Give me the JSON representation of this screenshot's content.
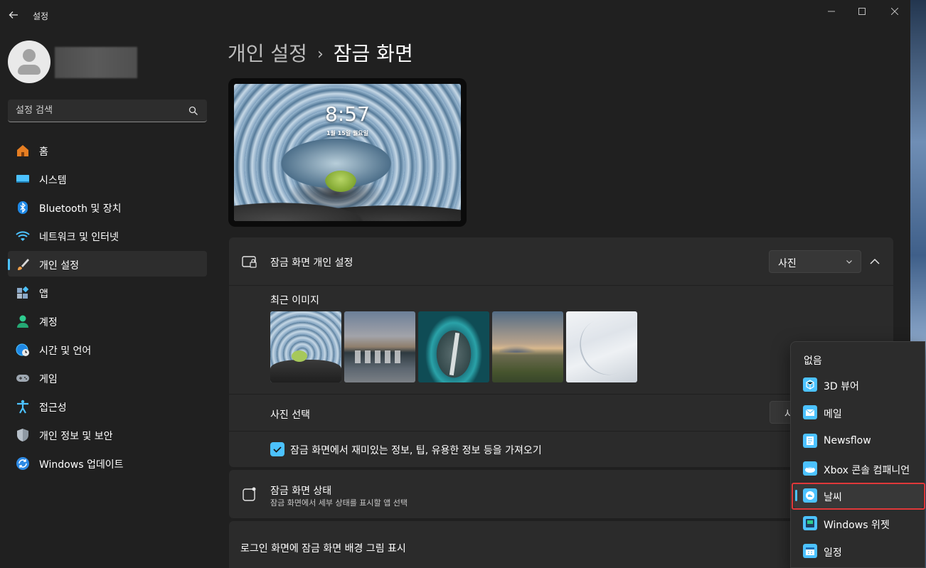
{
  "window": {
    "title": "설정",
    "back_icon": "arrow-left-icon",
    "controls": [
      "minimize-icon",
      "maximize-icon",
      "close-icon"
    ]
  },
  "sidebar": {
    "search_placeholder": "설정 검색",
    "items": [
      {
        "label": "홈",
        "icon": "home-icon",
        "color": "#e67e22"
      },
      {
        "label": "시스템",
        "icon": "system-icon",
        "color": "#4cc2ff"
      },
      {
        "label": "Bluetooth 및 장치",
        "icon": "bluetooth-icon",
        "color": "#1e88e5"
      },
      {
        "label": "네트워크 및 인터넷",
        "icon": "wifi-icon",
        "color": "#4cc2ff"
      },
      {
        "label": "개인 설정",
        "icon": "brush-icon",
        "color": "#f0a04b",
        "active": true
      },
      {
        "label": "앱",
        "icon": "apps-icon",
        "color": "#8aa8c8"
      },
      {
        "label": "계정",
        "icon": "account-icon",
        "color": "#2ecc8f"
      },
      {
        "label": "시간 및 언어",
        "icon": "globe-clock-icon",
        "color": "#4cc2ff"
      },
      {
        "label": "게임",
        "icon": "gamepad-icon",
        "color": "#9ea7b1"
      },
      {
        "label": "접근성",
        "icon": "accessibility-icon",
        "color": "#4cc2ff"
      },
      {
        "label": "개인 정보 및 보안",
        "icon": "shield-icon",
        "color": "#8f99a3"
      },
      {
        "label": "Windows 업데이트",
        "icon": "update-icon",
        "color": "#2d8ae5"
      }
    ]
  },
  "main": {
    "breadcrumb_parent": "개인 설정",
    "breadcrumb_current": "잠금 화면",
    "preview": {
      "time": "8:57",
      "date": "1월 15일 월요일"
    },
    "lock_card": {
      "title": "잠금 화면 개인 설정",
      "dropdown_value": "사진",
      "recent_label": "최근 이미지",
      "photo_select_label": "사진 선택",
      "browse_label": "사",
      "checkbox_label": "잠금 화면에서 재미있는 정보, 팁, 유용한 정보 등을 가져오기",
      "checkbox_checked": true
    },
    "status_card": {
      "title": "잠금 화면 상태",
      "subtitle": "잠금 화면에서 세부 상태를 표시할 앱 선택"
    },
    "signin_card": {
      "title": "로그인 화면에 잠금 화면 배경 그림 표시"
    }
  },
  "popup_menu": {
    "items": [
      {
        "label": "없음",
        "icon": ""
      },
      {
        "label": "3D 뷰어",
        "icon": "cube-icon"
      },
      {
        "label": "메일",
        "icon": "mail-icon"
      },
      {
        "label": "Newsflow",
        "icon": "news-icon"
      },
      {
        "label": "Xbox 콘솔 컴패니언",
        "icon": "xbox-icon"
      },
      {
        "label": "날씨",
        "icon": "weather-icon",
        "selected": true
      },
      {
        "label": "Windows 위젯",
        "icon": "widgets-icon"
      },
      {
        "label": "일정",
        "icon": "calendar-icon"
      }
    ],
    "accent_color": "#4cc2ff",
    "highlight_color": "#e0383a"
  }
}
